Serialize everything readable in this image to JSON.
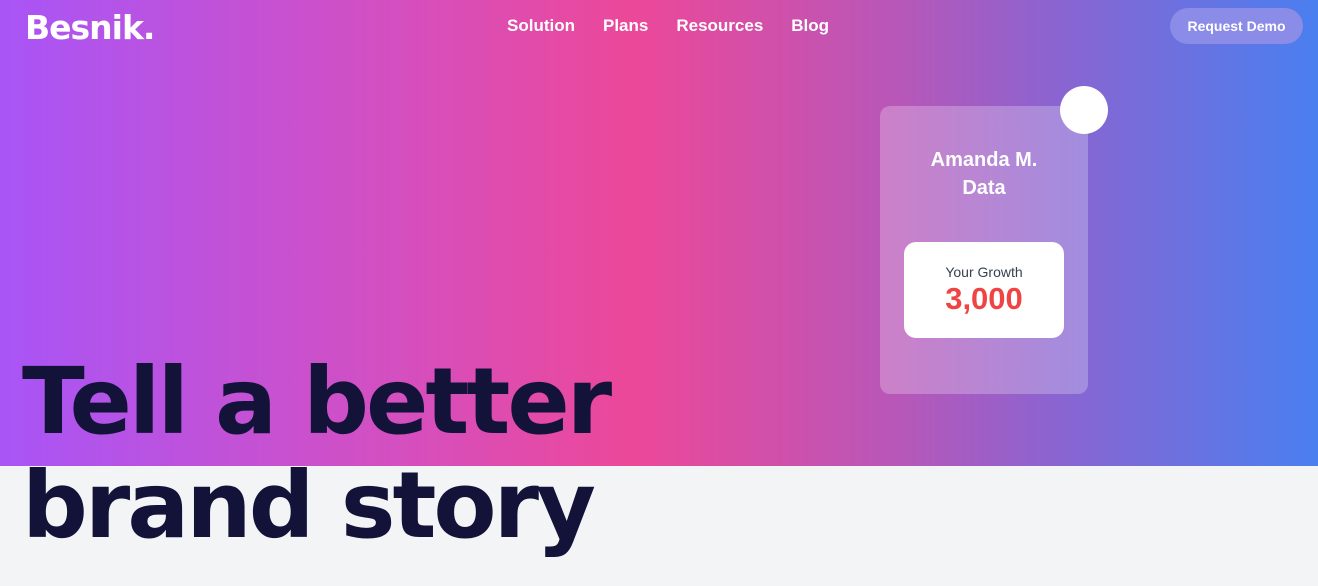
{
  "header": {
    "logo": "Besnik.",
    "nav": [
      {
        "label": "Solution"
      },
      {
        "label": "Plans"
      },
      {
        "label": "Resources"
      },
      {
        "label": "Blog"
      }
    ],
    "cta_label": "Request Demo"
  },
  "hero": {
    "headline_line1": "Tell a better",
    "headline_line2": "brand story"
  },
  "profile_card": {
    "name_line1": "Amanda M.",
    "name_line2": "Data",
    "growth_label": "Your Growth",
    "growth_value": "3,000"
  },
  "colors": {
    "headline": "#13133a",
    "growth_value": "#ef4444",
    "page_background": "#f3f4f6",
    "cta_background": "#8b8be8"
  }
}
